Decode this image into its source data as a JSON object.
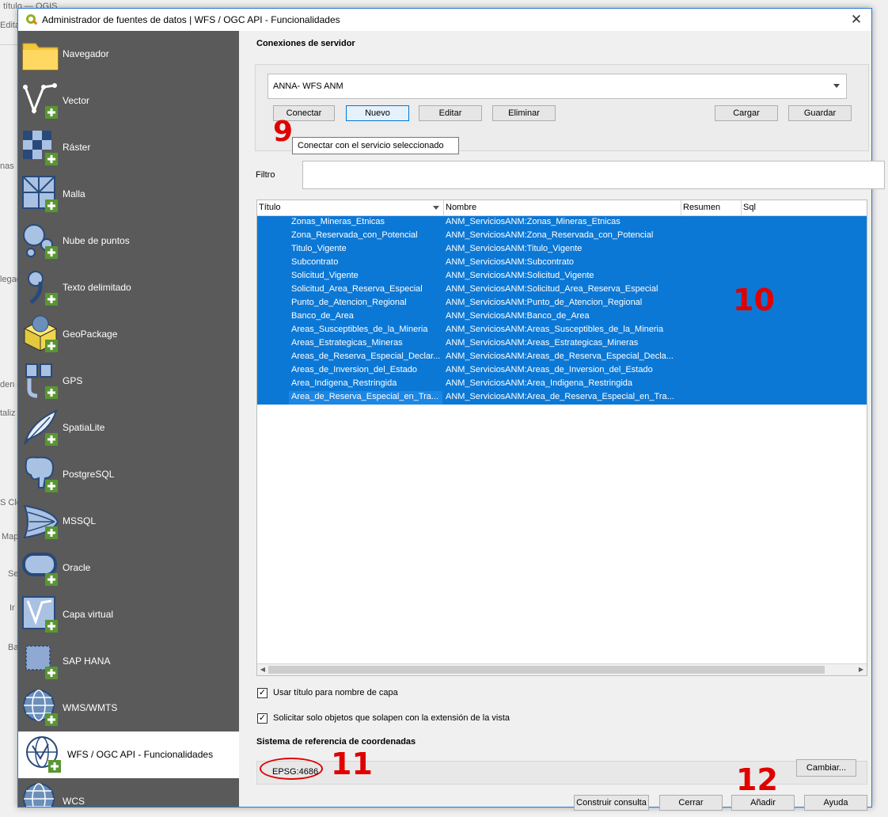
{
  "dialog": {
    "title": "Administrador de fuentes de datos | WFS / OGC API - Funcionalidades",
    "close_glyph": "✕"
  },
  "background": {
    "fragments": [
      "título — QGIS",
      "Editar",
      "nas",
      "legad",
      "den c",
      "taliz",
      "S Clo",
      "Map",
      "Se",
      "Ir",
      "Ba"
    ]
  },
  "sidebar": {
    "items": [
      {
        "label": "Navegador",
        "icon": "folder-icon"
      },
      {
        "label": "Vector",
        "icon": "vector-icon"
      },
      {
        "label": "Ráster",
        "icon": "raster-icon"
      },
      {
        "label": "Malla",
        "icon": "mesh-icon"
      },
      {
        "label": "Nube de puntos",
        "icon": "point-cloud-icon"
      },
      {
        "label": "Texto delimitado",
        "icon": "comma-icon"
      },
      {
        "label": "GeoPackage",
        "icon": "geopackage-icon"
      },
      {
        "label": "GPS",
        "icon": "gps-icon"
      },
      {
        "label": "SpatiaLite",
        "icon": "feather-icon"
      },
      {
        "label": "PostgreSQL",
        "icon": "elephant-icon"
      },
      {
        "label": "MSSQL",
        "icon": "mssql-icon"
      },
      {
        "label": "Oracle",
        "icon": "oracle-icon"
      },
      {
        "label": "Capa virtual",
        "icon": "virtual-layer-icon"
      },
      {
        "label": "SAP HANA",
        "icon": "hana-icon"
      },
      {
        "label": "WMS/WMTS",
        "icon": "globe-icon"
      },
      {
        "label": "WFS / OGC API - Funcionalidades",
        "icon": "wfs-icon"
      },
      {
        "label": "WCS",
        "icon": "globe-icon"
      }
    ],
    "active_index": 15
  },
  "connections": {
    "section_title": "Conexiones de servidor",
    "selected": "ANNA- WFS ANM",
    "buttons": {
      "connect": "Conectar",
      "new": "Nuevo",
      "edit": "Editar",
      "delete": "Eliminar",
      "load": "Cargar",
      "save": "Guardar"
    },
    "tooltip": "Conectar con el servicio seleccionado"
  },
  "filter": {
    "label": "Filtro",
    "value": ""
  },
  "table": {
    "headers": [
      "Título",
      "Nombre",
      "Resumen",
      "Sql"
    ],
    "rows": [
      {
        "title": "Zonas_Mineras_Etnicas",
        "name": "ANM_ServiciosANM:Zonas_Mineras_Etnicas"
      },
      {
        "title": "Zona_Reservada_con_Potencial",
        "name": "ANM_ServiciosANM:Zona_Reservada_con_Potencial"
      },
      {
        "title": "Titulo_Vigente",
        "name": "ANM_ServiciosANM:Titulo_Vigente"
      },
      {
        "title": "Subcontrato",
        "name": "ANM_ServiciosANM:Subcontrato"
      },
      {
        "title": "Solicitud_Vigente",
        "name": "ANM_ServiciosANM:Solicitud_Vigente"
      },
      {
        "title": "Solicitud_Area_Reserva_Especial",
        "name": "ANM_ServiciosANM:Solicitud_Area_Reserva_Especial"
      },
      {
        "title": "Punto_de_Atencion_Regional",
        "name": "ANM_ServiciosANM:Punto_de_Atencion_Regional"
      },
      {
        "title": "Banco_de_Area",
        "name": "ANM_ServiciosANM:Banco_de_Area"
      },
      {
        "title": "Areas_Susceptibles_de_la_Mineria",
        "name": "ANM_ServiciosANM:Areas_Susceptibles_de_la_Mineria"
      },
      {
        "title": "Areas_Estrategicas_Mineras",
        "name": "ANM_ServiciosANM:Areas_Estrategicas_Mineras"
      },
      {
        "title": "Areas_de_Reserva_Especial_Declar...",
        "name": "ANM_ServiciosANM:Areas_de_Reserva_Especial_Decla..."
      },
      {
        "title": "Areas_de_Inversion_del_Estado",
        "name": "ANM_ServiciosANM:Areas_de_Inversion_del_Estado"
      },
      {
        "title": "Area_Indigena_Restringida",
        "name": "ANM_ServiciosANM:Area_Indigena_Restringida"
      },
      {
        "title": "Area_de_Reserva_Especial_en_Tra...",
        "name": "ANM_ServiciosANM:Area_de_Reserva_Especial_en_Tra..."
      }
    ]
  },
  "options": {
    "use_title": {
      "label": "Usar título para nombre de capa",
      "checked": true
    },
    "only_extent": {
      "label": "Solicitar solo objetos que solapen con la extensión de la vista",
      "checked": true
    }
  },
  "crs": {
    "section_title": "Sistema de referencia de coordenadas",
    "value": "EPSG:4686",
    "change_button": "Cambiar..."
  },
  "footer": {
    "build_query": "Construir consulta",
    "close": "Cerrar",
    "add": "Añadir",
    "help": "Ayuda"
  },
  "annotations": {
    "a9": "9",
    "a10": "10",
    "a11": "11",
    "a12": "12"
  },
  "colors": {
    "accent": "#0c78d6",
    "sidebar": "#5a5a5a",
    "annotation": "#e00000"
  }
}
